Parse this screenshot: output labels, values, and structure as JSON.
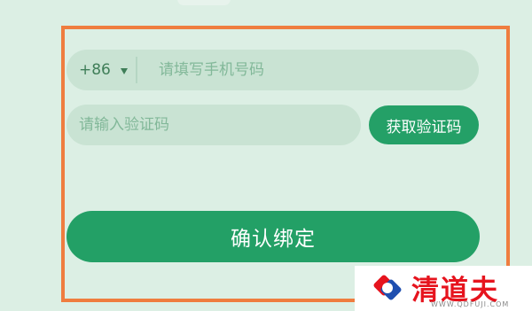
{
  "phone": {
    "country_code": "+86",
    "placeholder": "请填写手机号码",
    "value": ""
  },
  "verification": {
    "placeholder": "请输入验证码",
    "value": "",
    "get_code_label": "获取验证码"
  },
  "confirm": {
    "label": "确认绑定"
  },
  "watermark": {
    "name": "清道夫",
    "url": "WWW.QDFUJI.COM"
  },
  "colors": {
    "background": "#dcefe4",
    "field": "#c9e3d3",
    "button": "#23a066",
    "highlight_border": "#ef7d3f",
    "watermark_red": "#e6141e"
  },
  "icons": {
    "country_dropdown": "triangle-down-icon",
    "watermark_logo": "q-logo-icon"
  }
}
